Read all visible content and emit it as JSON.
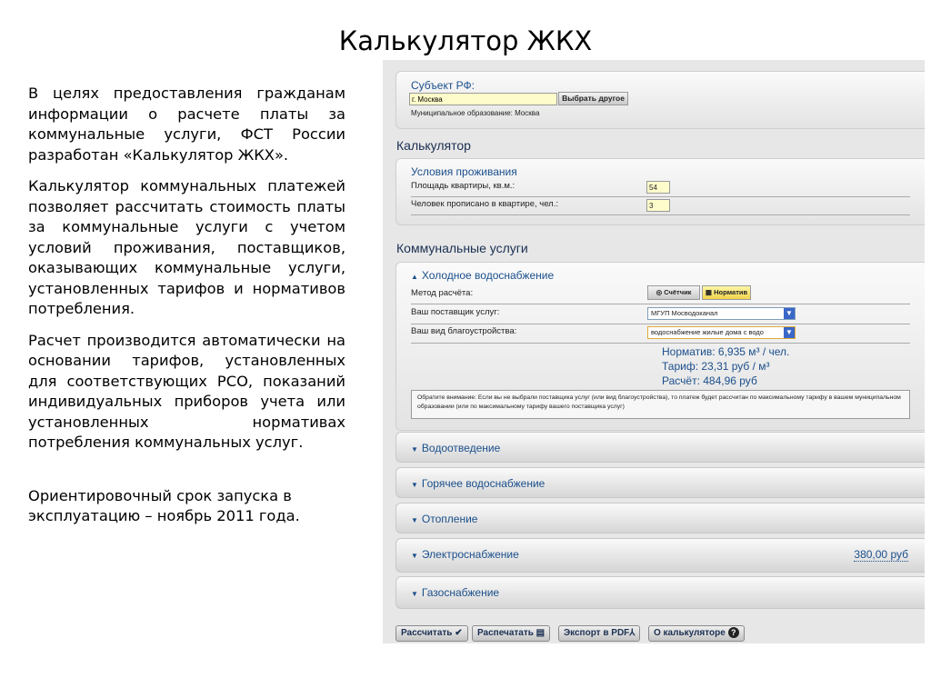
{
  "slide": {
    "title": "Калькулятор ЖКХ",
    "paragraphs": [
      "В целях предоставления гражданам информации о расчете платы за коммунальные услуги, ФСТ России разработан «Калькулятор ЖКХ».",
      "Калькулятор коммунальных платежей позволяет рассчитать стоимость платы за коммунальные услуги с учетом условий проживания, поставщиков, оказывающих коммунальные услуги, установленных тарифов и нормативов потребления.",
      "Расчет производится автоматически на основании тарифов, установленных для соответствующих РСО, показаний индивидуальных приборов учета или установленных нормативах потребления коммунальных услуг.",
      "Ориентировочный срок запуска в эксплуатацию – ноябрь 2011 года."
    ]
  },
  "calculator": {
    "region": {
      "label": "Субъект РФ:",
      "value": "г. Москва",
      "change_button": "Выбрать другое",
      "municipality": "Муниципальное образование: Москва"
    },
    "calc_title": "Калькулятор",
    "living": {
      "title": "Условия проживания",
      "area_label": "Площадь квартиры, кв.м.:",
      "area_value": "54",
      "people_label": "Человек прописано в квартире, чел.:",
      "people_value": "3"
    },
    "utilities_title": "Коммунальные услуги",
    "cold_water": {
      "title": "Холодное водоснабжение",
      "method_label": "Метод расчёта:",
      "method_options": [
        "Счётчик",
        "Норматив"
      ],
      "supplier_label": "Ваш поставщик услуг:",
      "supplier_value": "МГУП Мосводоканал",
      "improvement_label": "Ваш вид благоустройства:",
      "improvement_value": "водоснабжение жилые дома с водо",
      "norm": "Норматив: 6,935 м³ / чел.",
      "tariff": "Тариф: 23,31 руб / м³",
      "calc": "Расчёт: 484,96 руб",
      "note": "Обратите внимание: Если вы не выбрали поставщика услуг (или вид благоустройства), то платеж будет рассчитан по максимальному тарифу в вашем муниципальном образовании (или по максимальному тарифу вашего поставщика услуг)"
    },
    "sections": [
      {
        "title": "Водоотведение"
      },
      {
        "title": "Горячее водоснабжение"
      },
      {
        "title": "Отопление"
      },
      {
        "title": "Электроснабжение",
        "amount": "380,00 руб"
      },
      {
        "title": "Газоснабжение"
      }
    ],
    "toolbar": {
      "calculate": "Рассчитать",
      "print": "Распечатать",
      "pdf": "Экспорт в PDF",
      "about": "О калькуляторе"
    }
  }
}
